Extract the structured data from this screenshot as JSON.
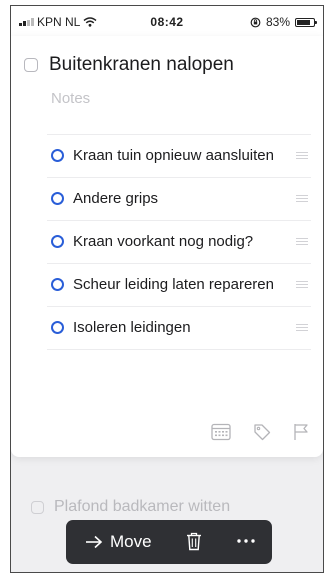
{
  "status_bar": {
    "carrier": "KPN NL",
    "time": "08:42",
    "battery_percent": "83%",
    "battery_level": 0.83,
    "signal_bars": 2,
    "icons": [
      "signal-icon",
      "wifi-icon",
      "rotation-lock-icon",
      "battery-icon"
    ]
  },
  "task": {
    "title": "Buitenkranen nalopen",
    "notes_placeholder": "Notes",
    "checklist": [
      {
        "label": "Kraan tuin opnieuw aansluiten"
      },
      {
        "label": "Andere grips"
      },
      {
        "label": "Kraan voorkant nog nodig?"
      },
      {
        "label": "Scheur leiding laten repareren"
      },
      {
        "label": "Isoleren leidingen"
      }
    ],
    "actions": [
      "calendar-icon",
      "tag-icon",
      "flag-icon"
    ]
  },
  "background_list": {
    "items": [
      {
        "label": "Plafond badkamer witten"
      }
    ]
  },
  "toolbar": {
    "move_label": "Move",
    "icons": [
      "arrow-right-icon",
      "trash-icon",
      "more-icon"
    ]
  },
  "colors": {
    "accent": "#2a5ed8",
    "toolbar_bg": "#2f3034",
    "background": "#efeff1"
  }
}
